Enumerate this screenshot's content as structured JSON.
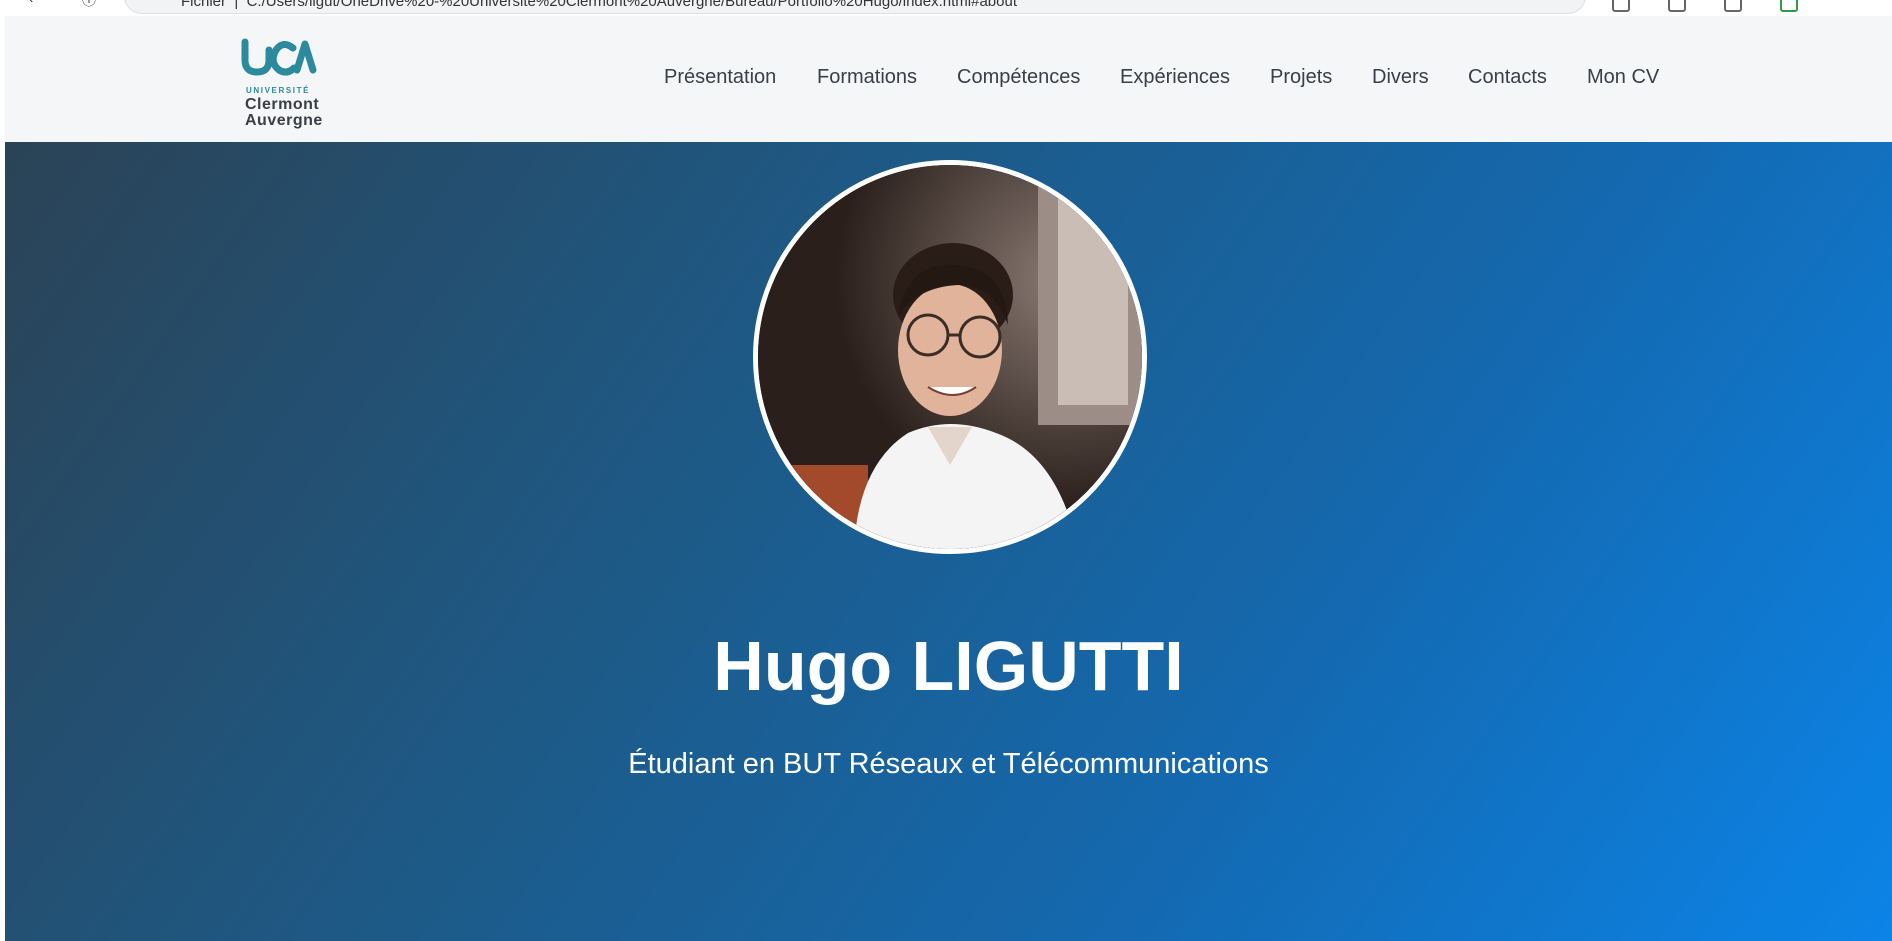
{
  "browser": {
    "address_prefix": "Fichier",
    "address_url": "C:/Users/ligut/OneDrive%20-%20Université%20Clermont%20Auvergne/Bureau/Portfolio%20Hugo/index.html#about"
  },
  "logo": {
    "line1": "UNIVERSITÉ",
    "line2": "Clermont",
    "line3": "Auvergne"
  },
  "nav": {
    "items": [
      {
        "label": "Présentation"
      },
      {
        "label": "Formations"
      },
      {
        "label": "Compétences"
      },
      {
        "label": "Expériences"
      },
      {
        "label": "Projets"
      },
      {
        "label": "Divers"
      },
      {
        "label": "Contacts"
      },
      {
        "label": "Mon CV"
      }
    ]
  },
  "hero": {
    "name": "Hugo LIGUTTI",
    "subtitle": "Étudiant en BUT Réseaux et Télécommunications"
  },
  "colors": {
    "accent_teal": "#2b8a9c",
    "hero_start": "#2b4356",
    "hero_end": "#0b84e8"
  }
}
